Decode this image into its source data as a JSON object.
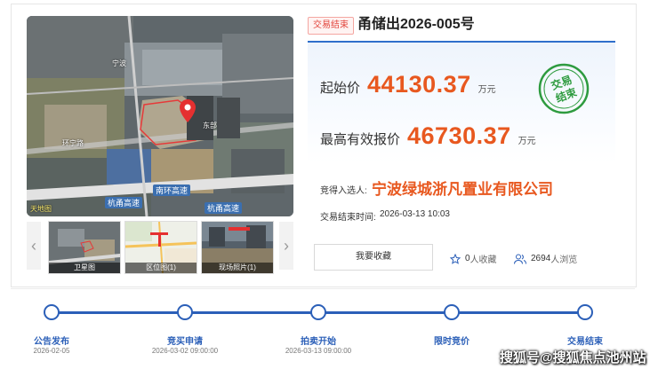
{
  "lot": {
    "status_badge": "交易结束",
    "title": "甬储出2026-005号"
  },
  "prices": {
    "start_label": "起始价",
    "start_value": "44130.37",
    "start_unit": "万元",
    "max_label": "最高有效报价",
    "max_value": "46730.37",
    "max_unit": "万元"
  },
  "stamp": {
    "line1": "交易",
    "line2": "结束",
    "color": "#2e9b3f"
  },
  "winner": {
    "label": "竞得入选人:",
    "name": "宁波绿城浙凡置业有限公司"
  },
  "end_time": {
    "label": "交易结束时间:",
    "value": "2026-03-13 10:03"
  },
  "actions": {
    "favorite_label": "我要收藏",
    "favorites_count": "0",
    "favorites_suffix": "人收藏",
    "views_count": "2694",
    "views_suffix": "人浏览"
  },
  "map": {
    "labels": [
      "宁波",
      "环宁路",
      "东部",
      "南环高速",
      "杭甬高速",
      "杭甬高速"
    ],
    "corner_mark": "天地图"
  },
  "gallery": {
    "prev_icon": "‹",
    "next_icon": "›",
    "thumbs": [
      {
        "caption": "卫星图"
      },
      {
        "caption": "区位图(1)"
      },
      {
        "caption": "现场照片(1)"
      }
    ]
  },
  "timeline": [
    {
      "label": "公告发布",
      "date": "2026-02-05"
    },
    {
      "label": "竞买申请",
      "date": "2026-03-02 09:00:00"
    },
    {
      "label": "拍卖开始",
      "date": "2026-03-13 09:00:00"
    },
    {
      "label": "限时竞价",
      "date": ""
    },
    {
      "label": "交易结束",
      "date": ""
    }
  ],
  "watermark": "搜狐号@搜狐焦点池州站",
  "colors": {
    "accent_blue": "#2b5fb8",
    "price_orange": "#e8581f",
    "badge_red": "#e2453c"
  }
}
